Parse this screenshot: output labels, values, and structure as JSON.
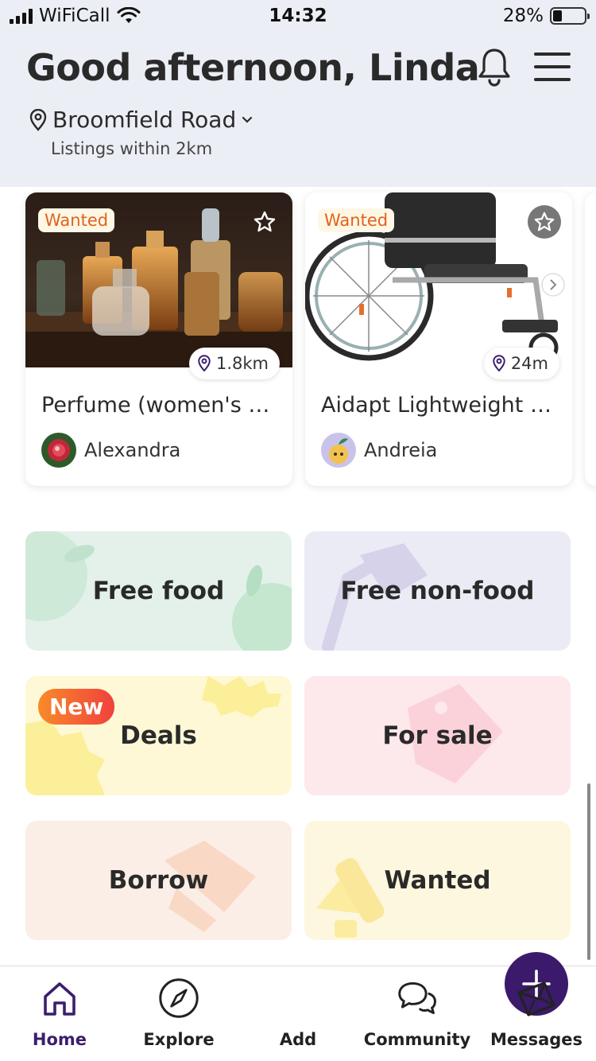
{
  "status_bar": {
    "carrier": "WiFiCall",
    "time": "14:32",
    "battery_percent": "28%",
    "battery_level": 0.28
  },
  "header": {
    "greeting": "Good afternoon, Linda",
    "location": "Broomfield Road",
    "location_sub": "Listings within 2km",
    "icons": [
      "bell-icon",
      "menu-icon",
      "location-pin-icon",
      "chevron-down-icon"
    ]
  },
  "listings": [
    {
      "tag": "Wanted",
      "distance": "1.8km",
      "title": "Perfume (women's and men's)",
      "user": "Alexandra"
    },
    {
      "tag": "Wanted",
      "distance": "24m",
      "title": "Aidapt Lightweight wheelchair",
      "user": "Andreia"
    }
  ],
  "categories": [
    {
      "label": "Free food",
      "bg": "#e4f1ea"
    },
    {
      "label": "Free non-food",
      "bg": "#ebebf5"
    },
    {
      "label": "Deals",
      "bg": "#fef8d6",
      "badge": "New"
    },
    {
      "label": "For sale",
      "bg": "#fde8ec"
    },
    {
      "label": "Borrow",
      "bg": "#fbeee6"
    },
    {
      "label": "Wanted",
      "bg": "#fdf7df"
    }
  ],
  "nav": {
    "items": [
      "Home",
      "Explore",
      "Add",
      "Community",
      "Messages"
    ],
    "active": "Home",
    "accent": "#3b1a6b"
  }
}
